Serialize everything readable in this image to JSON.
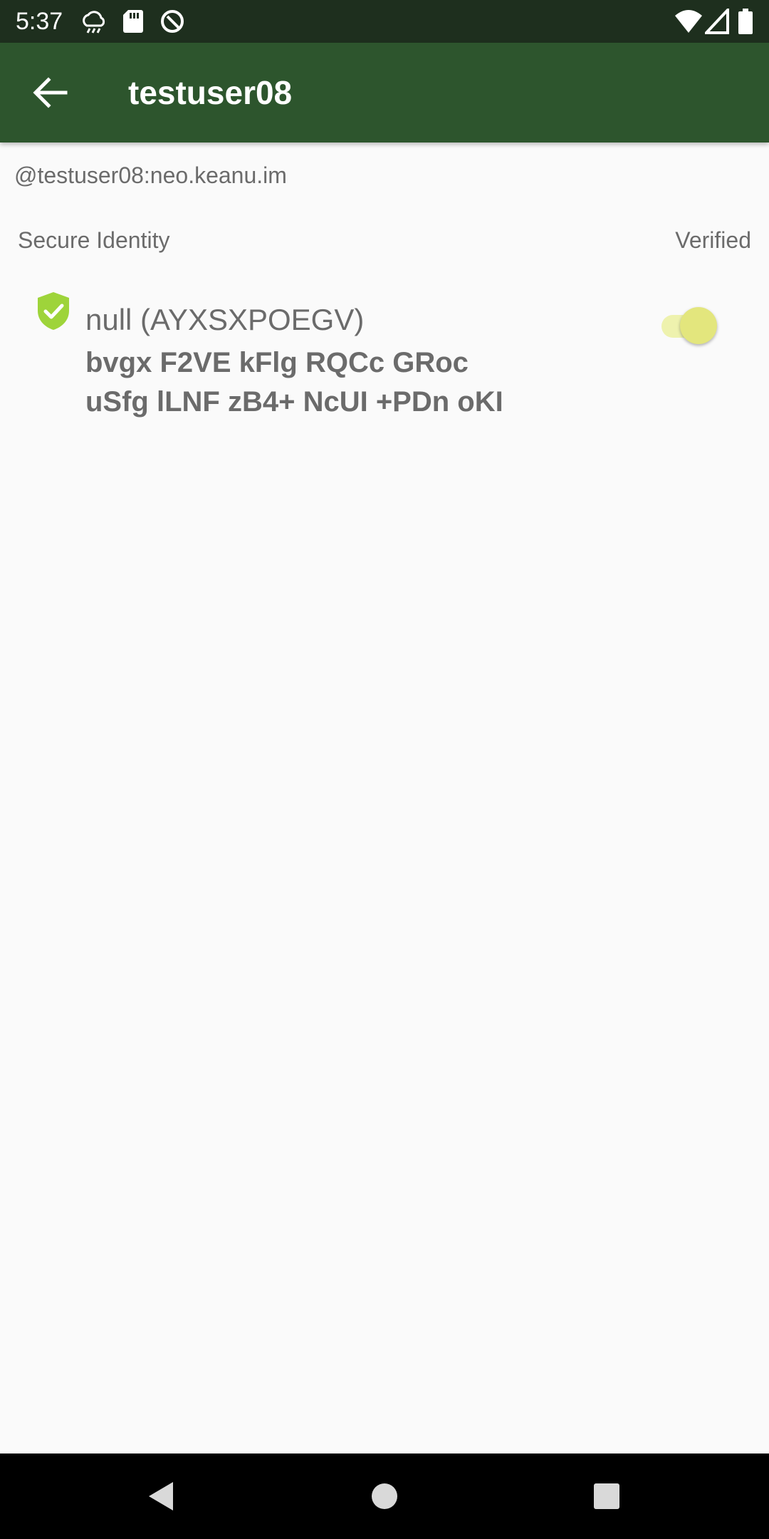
{
  "status_bar": {
    "time": "5:37",
    "left_icons": [
      "cloud-icon",
      "sd-card-icon",
      "sync-icon"
    ],
    "right_icons": [
      "wifi-icon",
      "signal-icon",
      "battery-icon"
    ]
  },
  "app_bar": {
    "title": "testuser08",
    "back_icon": "arrow-left-icon"
  },
  "profile": {
    "matrix_id": "@testuser08:neo.keanu.im"
  },
  "section": {
    "label": "Secure Identity",
    "right_label": "Verified"
  },
  "device": {
    "name": "null (AYXSXPOEGV)",
    "fingerprint_line1": "bvgx F2VE kFlg RQCc GRoc",
    "fingerprint_line2": "uSfg lLNF zB4+ NcUI +PDn oKI",
    "verified": true,
    "shield_color": "#9ed43a",
    "toggle_color": "#e3e67d"
  },
  "nav_bar": {
    "buttons": [
      "back-triangle-icon",
      "home-circle-icon",
      "recents-square-icon"
    ]
  }
}
